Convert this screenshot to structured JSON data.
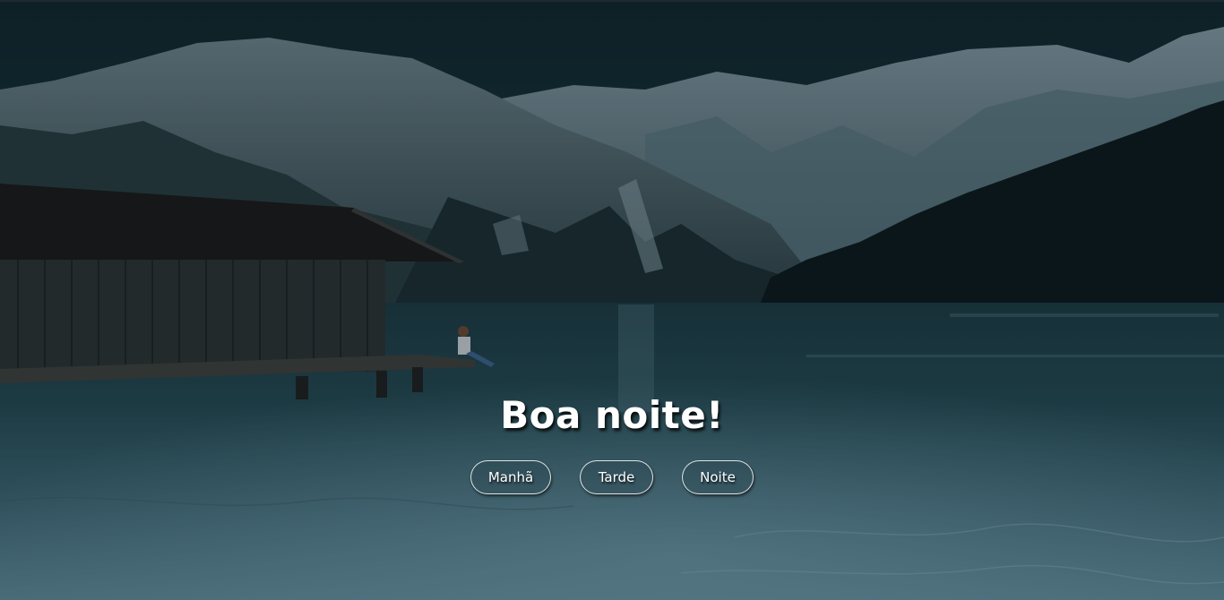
{
  "greeting": {
    "text": "Boa noite!"
  },
  "periods": {
    "morning": "Manhã",
    "afternoon": "Tarde",
    "night": "Noite"
  },
  "theme": {
    "overlay": "#0b1a20",
    "text": "#ffffff",
    "button_border": "#ffffff"
  },
  "background": {
    "icon": "lake-mountain-photo"
  }
}
